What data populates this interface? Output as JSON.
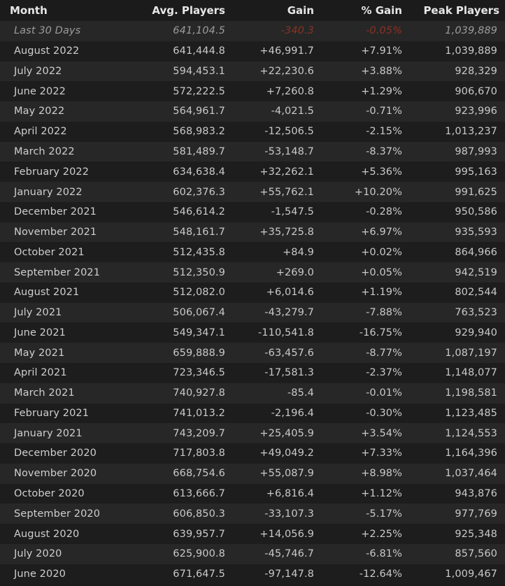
{
  "columns": [
    "Month",
    "Avg. Players",
    "Gain",
    "% Gain",
    "Peak Players"
  ],
  "summary_row": {
    "month": "Last 30 Days",
    "avg": "641,104.5",
    "gain": "-340.3",
    "pct": "-0.05%",
    "peak": "1,039,889"
  },
  "rows": [
    {
      "month": "August 2022",
      "avg": "641,444.8",
      "gain": "+46,991.7",
      "pct": "+7.91%",
      "peak": "1,039,889"
    },
    {
      "month": "July 2022",
      "avg": "594,453.1",
      "gain": "+22,230.6",
      "pct": "+3.88%",
      "peak": "928,329"
    },
    {
      "month": "June 2022",
      "avg": "572,222.5",
      "gain": "+7,260.8",
      "pct": "+1.29%",
      "peak": "906,670"
    },
    {
      "month": "May 2022",
      "avg": "564,961.7",
      "gain": "-4,021.5",
      "pct": "-0.71%",
      "peak": "923,996"
    },
    {
      "month": "April 2022",
      "avg": "568,983.2",
      "gain": "-12,506.5",
      "pct": "-2.15%",
      "peak": "1,013,237"
    },
    {
      "month": "March 2022",
      "avg": "581,489.7",
      "gain": "-53,148.7",
      "pct": "-8.37%",
      "peak": "987,993"
    },
    {
      "month": "February 2022",
      "avg": "634,638.4",
      "gain": "+32,262.1",
      "pct": "+5.36%",
      "peak": "995,163"
    },
    {
      "month": "January 2022",
      "avg": "602,376.3",
      "gain": "+55,762.1",
      "pct": "+10.20%",
      "peak": "991,625"
    },
    {
      "month": "December 2021",
      "avg": "546,614.2",
      "gain": "-1,547.5",
      "pct": "-0.28%",
      "peak": "950,586"
    },
    {
      "month": "November 2021",
      "avg": "548,161.7",
      "gain": "+35,725.8",
      "pct": "+6.97%",
      "peak": "935,593"
    },
    {
      "month": "October 2021",
      "avg": "512,435.8",
      "gain": "+84.9",
      "pct": "+0.02%",
      "peak": "864,966"
    },
    {
      "month": "September 2021",
      "avg": "512,350.9",
      "gain": "+269.0",
      "pct": "+0.05%",
      "peak": "942,519"
    },
    {
      "month": "August 2021",
      "avg": "512,082.0",
      "gain": "+6,014.6",
      "pct": "+1.19%",
      "peak": "802,544"
    },
    {
      "month": "July 2021",
      "avg": "506,067.4",
      "gain": "-43,279.7",
      "pct": "-7.88%",
      "peak": "763,523"
    },
    {
      "month": "June 2021",
      "avg": "549,347.1",
      "gain": "-110,541.8",
      "pct": "-16.75%",
      "peak": "929,940"
    },
    {
      "month": "May 2021",
      "avg": "659,888.9",
      "gain": "-63,457.6",
      "pct": "-8.77%",
      "peak": "1,087,197"
    },
    {
      "month": "April 2021",
      "avg": "723,346.5",
      "gain": "-17,581.3",
      "pct": "-2.37%",
      "peak": "1,148,077"
    },
    {
      "month": "March 2021",
      "avg": "740,927.8",
      "gain": "-85.4",
      "pct": "-0.01%",
      "peak": "1,198,581"
    },
    {
      "month": "February 2021",
      "avg": "741,013.2",
      "gain": "-2,196.4",
      "pct": "-0.30%",
      "peak": "1,123,485"
    },
    {
      "month": "January 2021",
      "avg": "743,209.7",
      "gain": "+25,405.9",
      "pct": "+3.54%",
      "peak": "1,124,553"
    },
    {
      "month": "December 2020",
      "avg": "717,803.8",
      "gain": "+49,049.2",
      "pct": "+7.33%",
      "peak": "1,164,396"
    },
    {
      "month": "November 2020",
      "avg": "668,754.6",
      "gain": "+55,087.9",
      "pct": "+8.98%",
      "peak": "1,037,464"
    },
    {
      "month": "October 2020",
      "avg": "613,666.7",
      "gain": "+6,816.4",
      "pct": "+1.12%",
      "peak": "943,876"
    },
    {
      "month": "September 2020",
      "avg": "606,850.3",
      "gain": "-33,107.3",
      "pct": "-5.17%",
      "peak": "977,769"
    },
    {
      "month": "August 2020",
      "avg": "639,957.7",
      "gain": "+14,056.9",
      "pct": "+2.25%",
      "peak": "925,348"
    },
    {
      "month": "July 2020",
      "avg": "625,900.8",
      "gain": "-45,746.7",
      "pct": "-6.81%",
      "peak": "857,560"
    },
    {
      "month": "June 2020",
      "avg": "671,647.5",
      "gain": "-97,147.8",
      "pct": "-12.64%",
      "peak": "1,009,467"
    }
  ],
  "colors": {
    "positive": "#5cb02e",
    "negative": "#b0402b",
    "row_odd": "#272727",
    "row_even": "#1d1d1d"
  }
}
